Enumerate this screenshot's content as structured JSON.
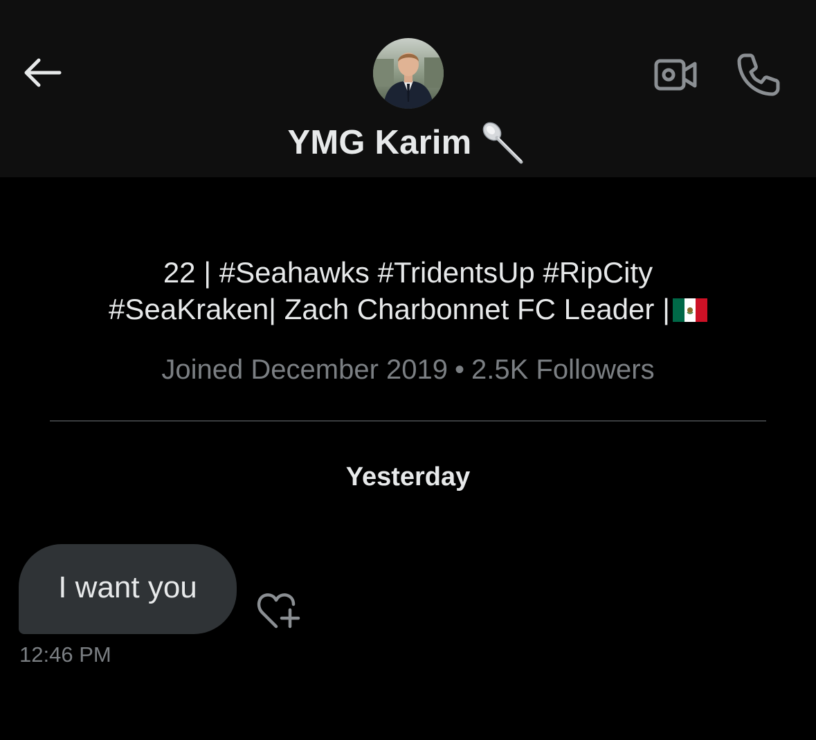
{
  "header": {
    "title": "YMG Karim",
    "title_emoji_icon": "spoon-icon",
    "back_icon": "arrow-left-icon",
    "video_icon": "video-camera-icon",
    "phone_icon": "phone-icon",
    "avatar": "profile-photo"
  },
  "profile": {
    "bio_line1": "22 | #Seahawks #TridentsUp #RipCity",
    "bio_line2": "#SeaKraken| Zach Charbonnet FC Leader |",
    "bio_flag_icon": "mexico-flag-icon",
    "joined": "Joined December 2019",
    "separator": "•",
    "followers": "2.5K Followers"
  },
  "conversation": {
    "date_label": "Yesterday",
    "messages": [
      {
        "text": "I want you",
        "time": "12:46 PM",
        "reaction_icon": "add-reaction-heart-icon"
      }
    ]
  },
  "colors": {
    "background": "#000000",
    "header_background": "#0f0f0f",
    "bubble": "#2f3336",
    "primary_text": "#e7e9ea",
    "secondary_text": "#7b7f83",
    "divider": "#3a3d40",
    "icon": "#8b8f93"
  }
}
